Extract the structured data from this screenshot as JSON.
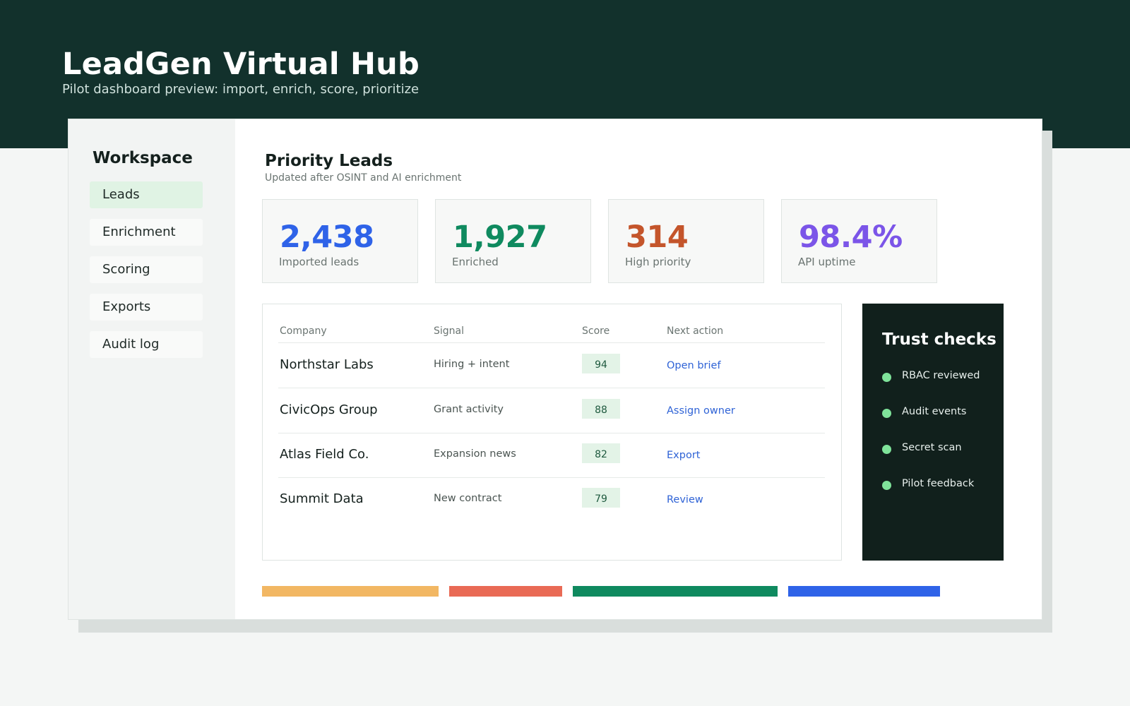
{
  "header": {
    "title": "LeadGen Virtual Hub",
    "subtitle": "Pilot dashboard preview: import, enrich, score, prioritize"
  },
  "sidebar": {
    "title": "Workspace",
    "items": [
      {
        "label": "Leads",
        "active": true
      },
      {
        "label": "Enrichment",
        "active": false
      },
      {
        "label": "Scoring",
        "active": false
      },
      {
        "label": "Exports",
        "active": false
      },
      {
        "label": "Audit log",
        "active": false
      }
    ]
  },
  "main": {
    "title": "Priority Leads",
    "subtitle": "Updated after OSINT and AI enrichment",
    "stats": [
      {
        "value": "2,438",
        "label": "Imported leads",
        "color": "#2f63e8"
      },
      {
        "value": "1,927",
        "label": "Enriched",
        "color": "#0f8a5f"
      },
      {
        "value": "314",
        "label": "High priority",
        "color": "#c4552b"
      },
      {
        "value": "98.4%",
        "label": "API uptime",
        "color": "#7b55e8"
      }
    ],
    "table": {
      "headers": [
        "Company",
        "Signal",
        "Score",
        "Next action"
      ],
      "rows": [
        {
          "company": "Northstar Labs",
          "signal": "Hiring + intent",
          "score": "94",
          "action": "Open brief"
        },
        {
          "company": "CivicOps Group",
          "signal": "Grant activity",
          "score": "88",
          "action": "Assign owner"
        },
        {
          "company": "Atlas Field Co.",
          "signal": "Expansion news",
          "score": "82",
          "action": "Export"
        },
        {
          "company": "Summit Data",
          "signal": "New contract",
          "score": "79",
          "action": "Review"
        }
      ]
    },
    "trust": {
      "title": "Trust checks",
      "items": [
        "RBAC reviewed",
        "Audit events",
        "Secret scan",
        "Pilot feedback"
      ],
      "dot_color": "#7fe39a"
    },
    "color_bars": [
      "#f2b763",
      "#e96a55",
      "#0f8a5f",
      "#2f63e8"
    ]
  }
}
